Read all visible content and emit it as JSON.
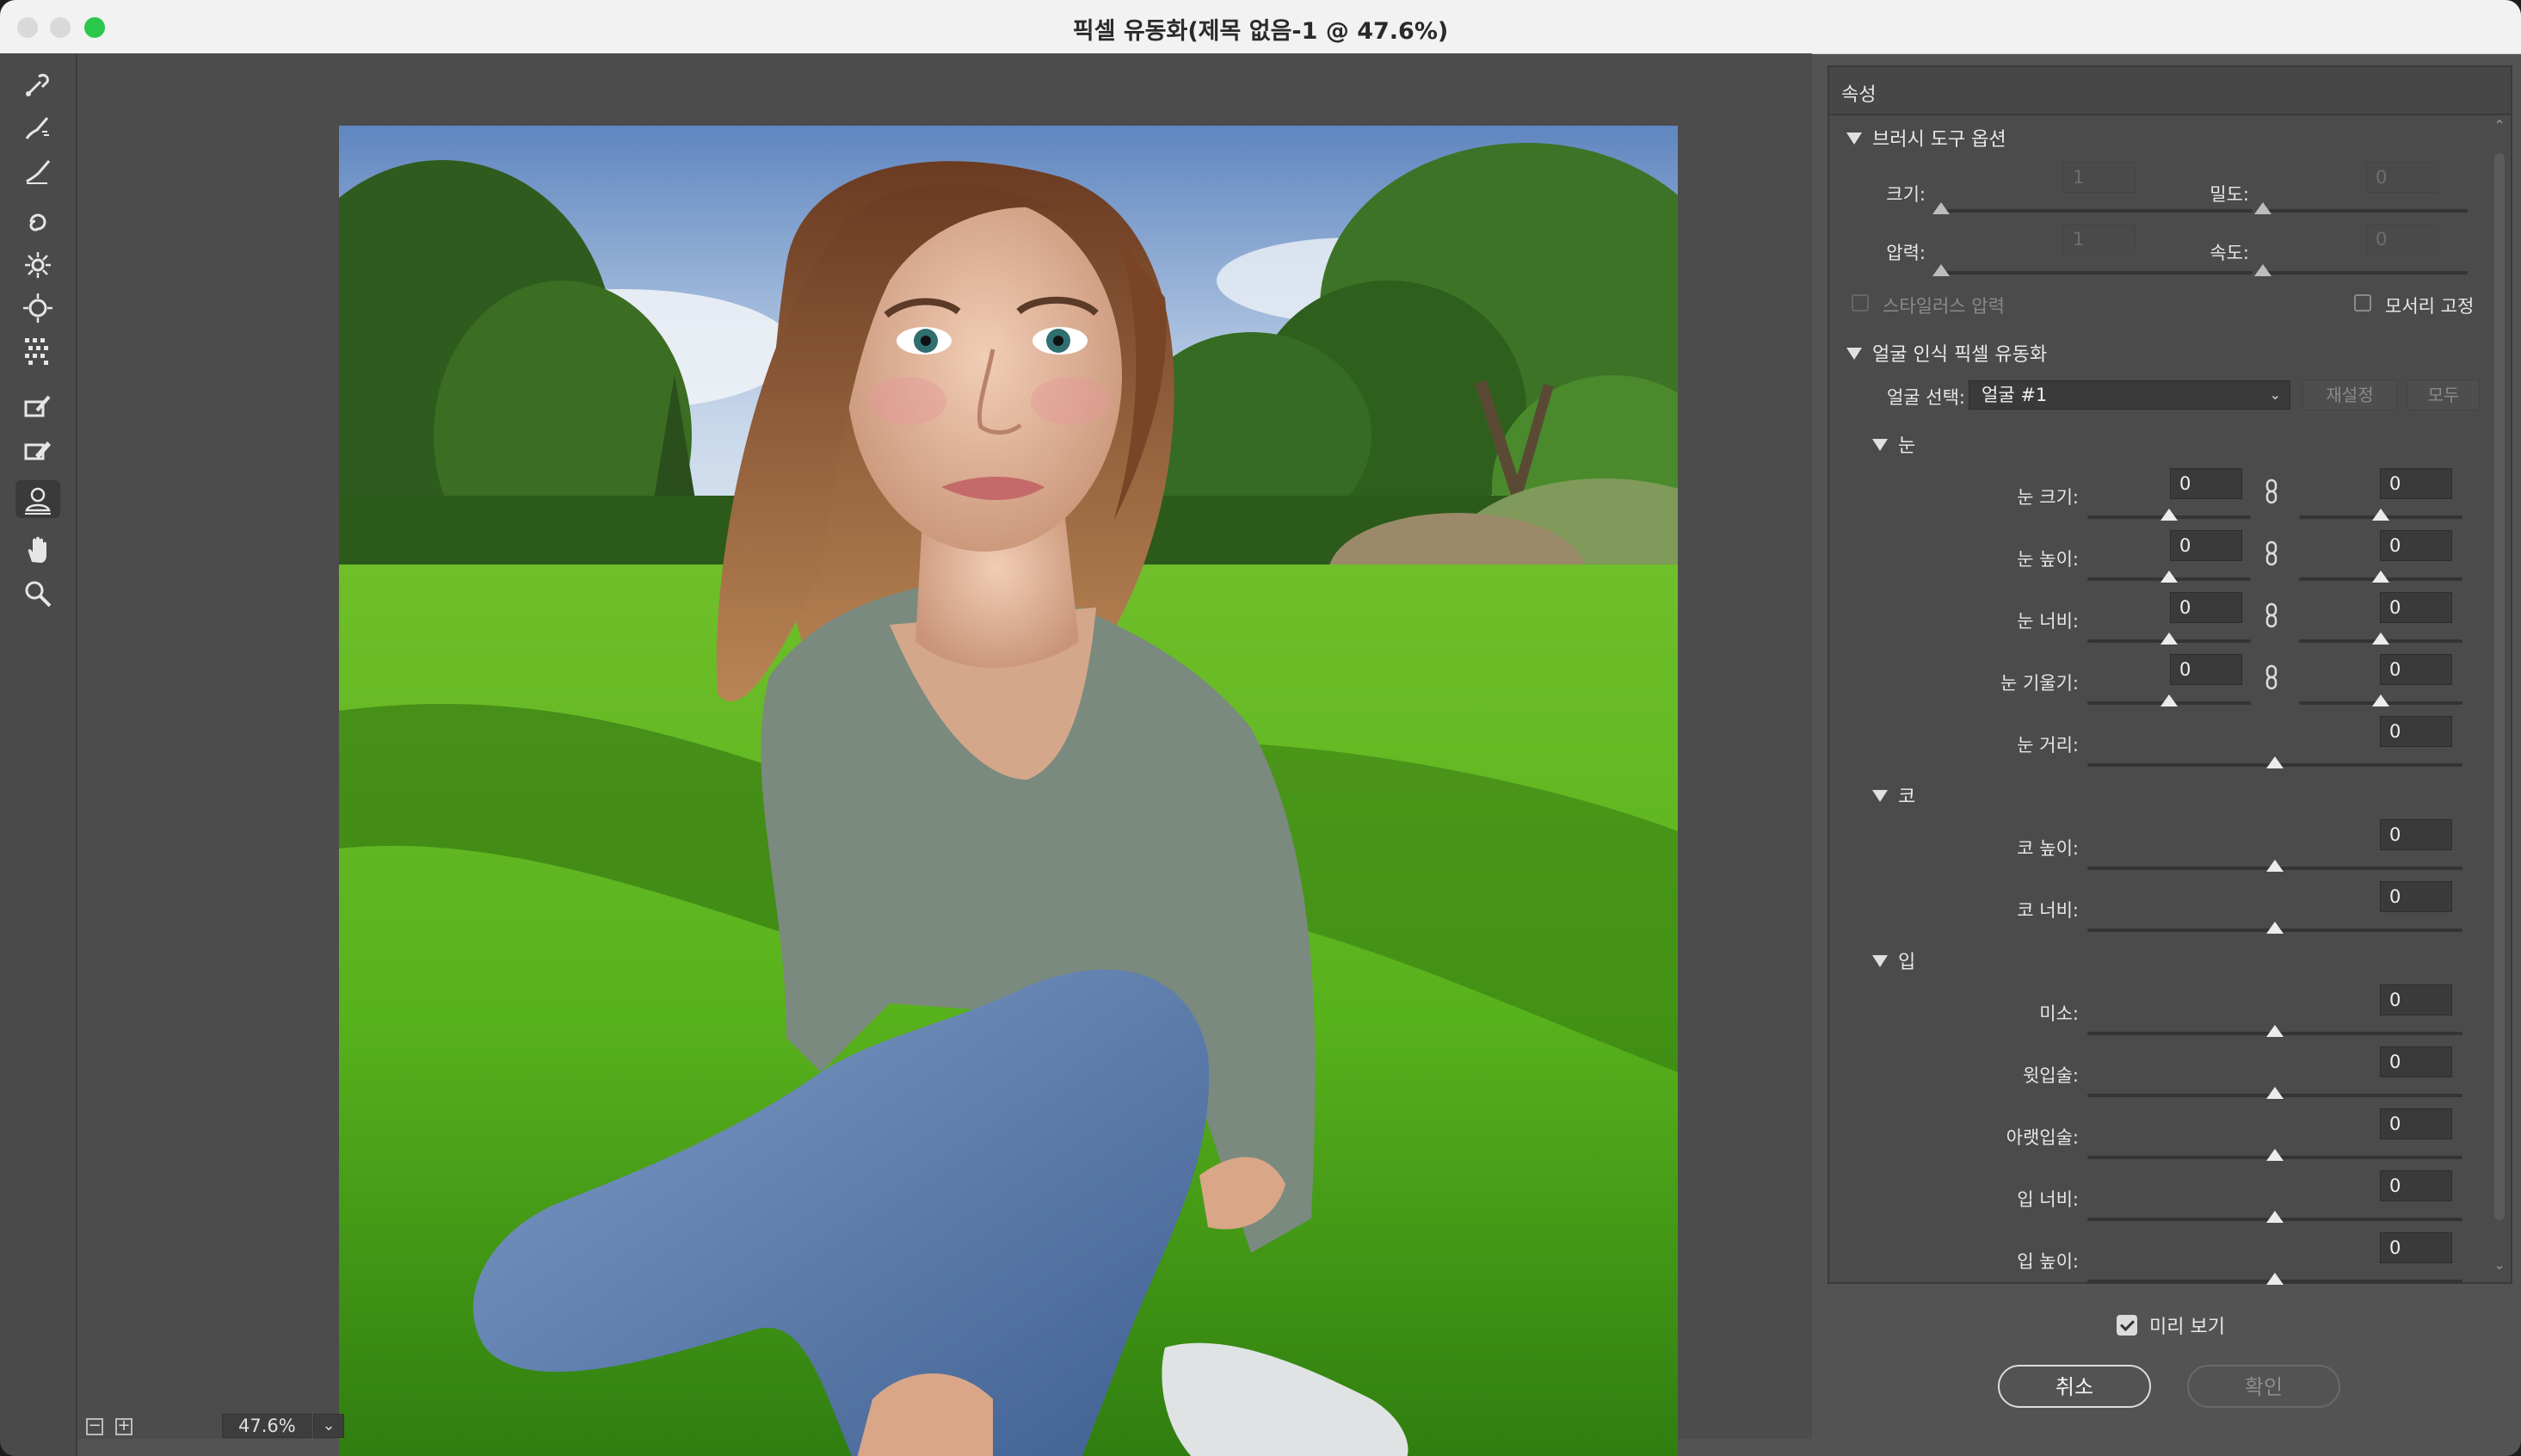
{
  "window": {
    "title": "픽셀 유동화(제목 없음-1 @ 47.6%)"
  },
  "tools": [
    {
      "icon": "forward-warp-tool-icon"
    },
    {
      "icon": "reconstruct-tool-icon"
    },
    {
      "icon": "smooth-tool-icon"
    },
    {
      "icon": "twirl-clockwise-tool-icon"
    },
    {
      "icon": "pucker-tool-icon"
    },
    {
      "icon": "bloat-tool-icon"
    },
    {
      "icon": "push-left-tool-icon"
    },
    {
      "icon": "freeze-mask-tool-icon"
    },
    {
      "icon": "thaw-mask-tool-icon"
    },
    {
      "icon": "face-tool-icon"
    },
    {
      "icon": "hand-tool-icon"
    },
    {
      "icon": "zoom-tool-icon"
    }
  ],
  "canvas": {
    "zoom": "47.6%"
  },
  "properties": {
    "title": "속성",
    "brush": {
      "header": "브러시 도구 옵션",
      "size_label": "크기:",
      "size_value": "1",
      "density_label": "밀도:",
      "density_value": "0",
      "pressure_label": "압력:",
      "pressure_value": "1",
      "rate_label": "속도:",
      "rate_value": "0",
      "stylus_label": "스타일러스 압력",
      "pin_edges_label": "모서리 고정"
    },
    "face": {
      "header": "얼굴 인식 픽셀 유동화",
      "select_label": "얼굴 선택:",
      "select_value": "얼굴 #1",
      "reset_label": "재설정",
      "all_label": "모두",
      "eyes": {
        "header": "눈",
        "rows": [
          {
            "label": "눈 크기:",
            "left": "0",
            "right": "0"
          },
          {
            "label": "눈 높이:",
            "left": "0",
            "right": "0"
          },
          {
            "label": "눈 너비:",
            "left": "0",
            "right": "0"
          },
          {
            "label": "눈 기울기:",
            "left": "0",
            "right": "0"
          }
        ],
        "distance": {
          "label": "눈 거리:",
          "value": "0"
        }
      },
      "nose": {
        "header": "코",
        "rows": [
          {
            "label": "코 높이:",
            "value": "0"
          },
          {
            "label": "코 너비:",
            "value": "0"
          }
        ]
      },
      "mouth": {
        "header": "입",
        "rows": [
          {
            "label": "미소:",
            "value": "0"
          },
          {
            "label": "윗입술:",
            "value": "0"
          },
          {
            "label": "아랫입술:",
            "value": "0"
          },
          {
            "label": "입 너비:",
            "value": "0"
          },
          {
            "label": "입 높이:",
            "value": "0"
          }
        ]
      }
    }
  },
  "footer": {
    "preview_label": "미리 보기",
    "cancel_label": "취소",
    "ok_label": "확인"
  }
}
